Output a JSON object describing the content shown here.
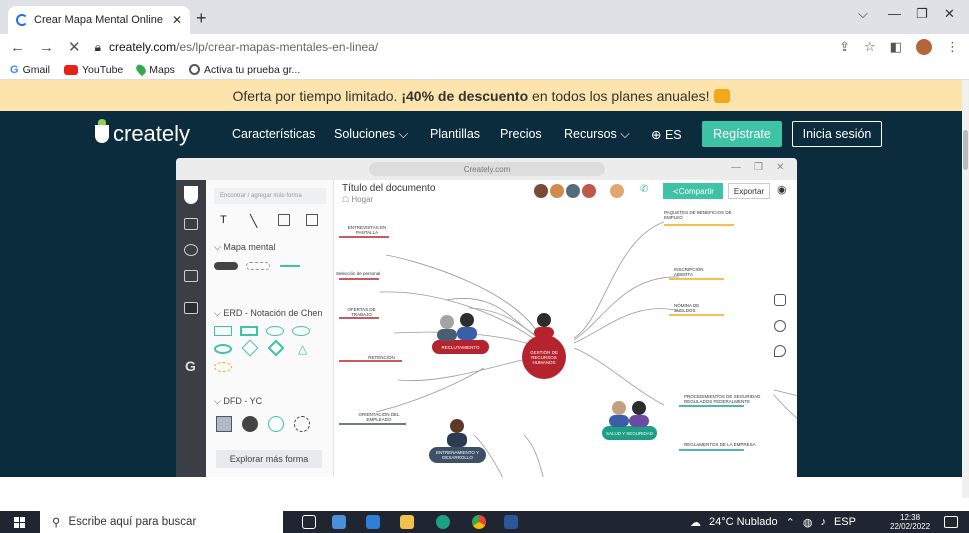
{
  "browser": {
    "tab_title": "Crear Mapa Mental Online | Prog",
    "url_host": "creately.com",
    "url_path": "/es/lp/crear-mapas-mentales-en-linea/",
    "bookmarks": [
      "Gmail",
      "YouTube",
      "Maps",
      "Activa tu prueba gr..."
    ]
  },
  "promo": {
    "text_before": "Oferta por tiempo limitado. ",
    "text_bold": "¡40% de descuento",
    "text_after": " en todos los planes anuales!"
  },
  "nav": {
    "logo": "creately",
    "links": [
      "Características",
      "Soluciones ⌵",
      "Plantillas",
      "Precios",
      "Recursos ⌵",
      "⊕ ES"
    ],
    "register": "Regístrate",
    "login": "Inicia sesión"
  },
  "app": {
    "url": "Creately.com",
    "search_placeholder": "Encontrar / agregar más forma",
    "section_mindmap": "Mapa mental",
    "section_erd": "ERD - Notación de Chen",
    "section_dfd": "DFD - YC",
    "explore_button": "Explorar más forma",
    "doc_title": "Título del documento",
    "doc_location": "Hogar",
    "share": "Compartir",
    "export": "Exportar"
  },
  "mindmap": {
    "center": "GESTIÓN DE RECURSOS HUMANOS",
    "recruit": "RECLUTAMIENTO",
    "health": "SALUD Y SEGURIDAD",
    "training": "ENTRENAMIENTO Y DESARROLLO",
    "labels": {
      "interviews": "ENTREVISTAS EN PANTALLA",
      "selection": "Selección de personal",
      "offers": "OFERTAS DE TRABAJO",
      "retention": "RETENCIÓN",
      "orientation": "ORIENTACIÓN DEL EMPLEADO",
      "benefits": "PAQUETES DE BENEFICIOS DE EMPLEO",
      "enrollment": "INSCRIPCIÓN ABIERTA",
      "payroll": "NÓMINA DE SUELDOS",
      "procedures": "PROCEDIMIENTOS DE SEGURIDAD REGULADOS FEDERALMENTE",
      "regulations": "REGLAMENTOS DE LA EMPRESA"
    }
  },
  "taskbar": {
    "search": "Escribe aquí para buscar",
    "weather": "24°C  Nublado",
    "lang": "ESP",
    "time": "12:38",
    "date": "22/02/2022"
  },
  "colors": {
    "promo_bg": "#fde4ac",
    "hero_bg": "#0b2c3d",
    "accent": "#3ec3a4",
    "node_red": "#b5232e",
    "node_slate": "#3e5066",
    "node_teal": "#1e9e86"
  }
}
